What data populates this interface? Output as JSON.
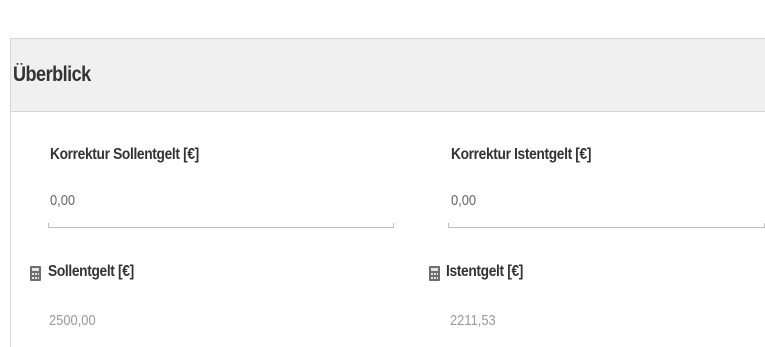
{
  "panel": {
    "title": "Überblick"
  },
  "fields": {
    "korrektur_sollentgelt": {
      "label": "Korrektur Sollentgelt [€]",
      "value": "0,00"
    },
    "korrektur_istentgelt": {
      "label": "Korrektur Istentgelt [€]",
      "value": "0,00"
    },
    "sollentgelt": {
      "icon": "calculator-icon",
      "label": "Sollentgelt [€]",
      "value": "2500,00"
    },
    "istentgelt": {
      "icon": "calculator-icon",
      "label": "Istentgelt [€]",
      "value": "2211,53"
    }
  }
}
